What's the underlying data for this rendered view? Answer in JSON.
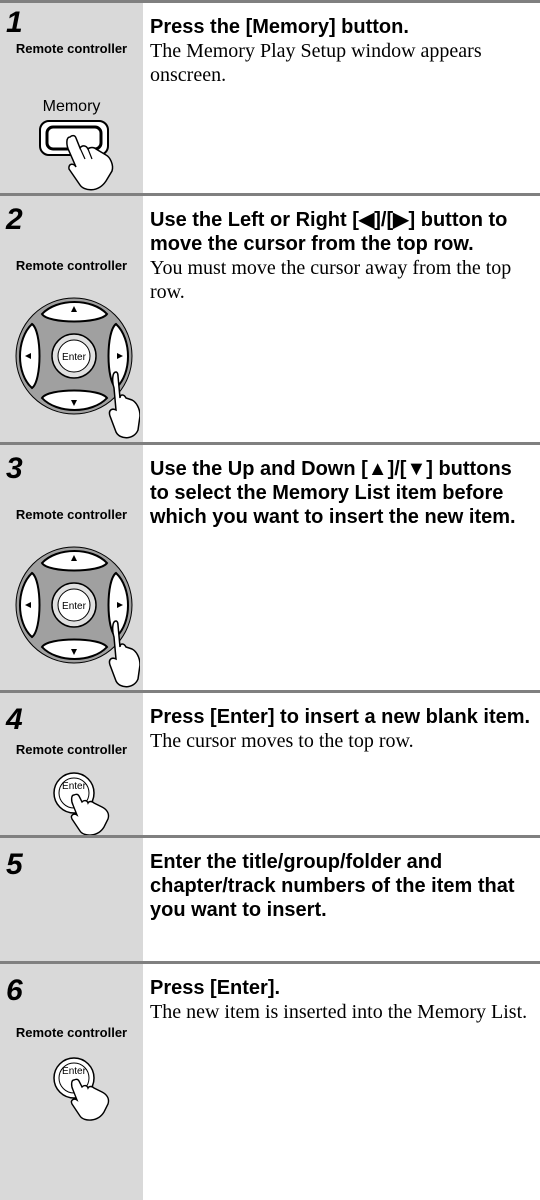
{
  "rc_label": "Remote controller",
  "steps": [
    {
      "num": "1",
      "head": "Press the [Memory] button.",
      "body": "The Memory Play Setup window appears onscreen.",
      "button_label": "Memory"
    },
    {
      "num": "2",
      "head": "Use the Left or Right [◀]/[▶] button to move the cursor from the top row.",
      "body": "You must move the cursor away from the top row.",
      "button_label": "Enter"
    },
    {
      "num": "3",
      "head": "Use the Up and Down [▲]/[▼] buttons to select the Memory List item before which you want to insert the new item.",
      "body": "",
      "button_label": "Enter"
    },
    {
      "num": "4",
      "head": "Press [Enter] to insert a new blank item.",
      "body": "The cursor moves to the top row.",
      "button_label": "Enter"
    },
    {
      "num": "5",
      "head": "Enter the title/group/folder and chapter/track numbers of the item that you want to insert.",
      "body": ""
    },
    {
      "num": "6",
      "head": "Press [Enter].",
      "body": "The new item is inserted into the Memory List.",
      "button_label": "Enter"
    }
  ]
}
